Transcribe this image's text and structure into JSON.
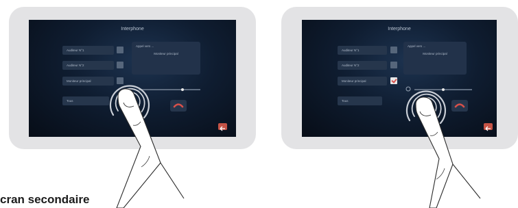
{
  "screens": [
    {
      "title": "Interphone",
      "buttons": [
        "Auditeur N°1",
        "Auditeur N°2",
        "Moniteur principal",
        "Tous"
      ],
      "checkboxes": [
        false,
        false,
        false
      ],
      "panel_line1": "Appel vers ...",
      "panel_line2": "Moniteur principal",
      "slider_level": 0.7
    },
    {
      "title": "Interphone",
      "buttons": [
        "Auditeur N°1",
        "Auditeur N°2",
        "Moniteur principal",
        "Tous"
      ],
      "checkboxes": [
        false,
        false,
        true
      ],
      "panel_line1": "Appel vers ...",
      "panel_line2": "Moniteur principal",
      "slider_level": 0.5
    }
  ],
  "caption": "cran secondaire",
  "colors": {
    "frame": "#e3e3e5",
    "accent_red": "#c55346",
    "screen_bg": "#0f1d31"
  },
  "icons": [
    "hangup-phone-icon",
    "back-arrow-icon",
    "volume-icon",
    "checkmark-icon"
  ]
}
